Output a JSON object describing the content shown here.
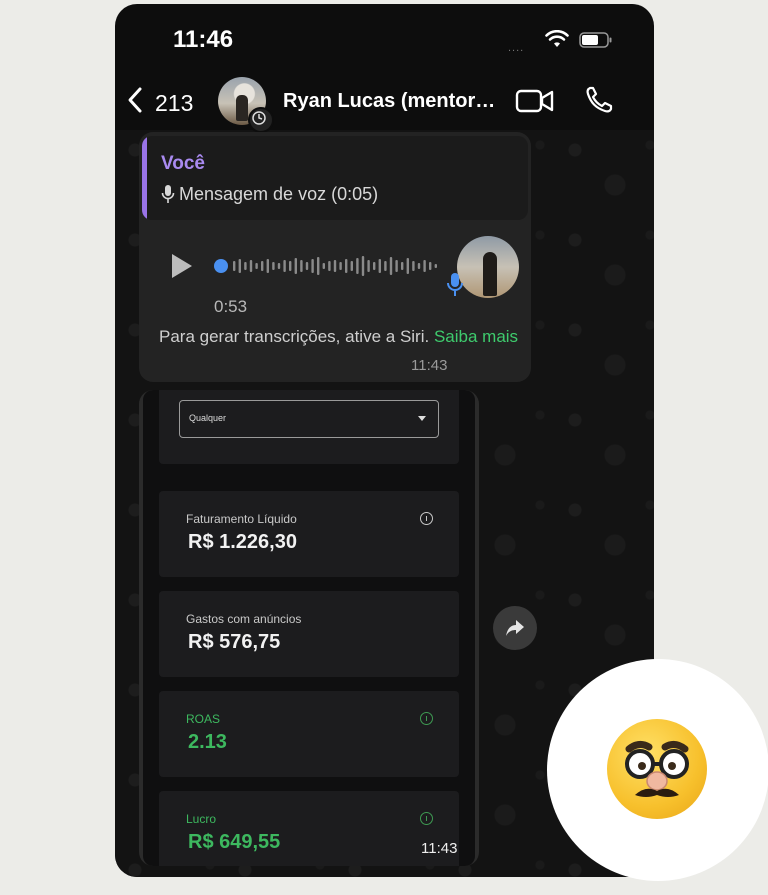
{
  "status_bar": {
    "time": "11:46",
    "signal": "....",
    "wifi_icon": "wifi-icon",
    "battery_icon": "battery-icon"
  },
  "header": {
    "back_count": "213",
    "contact_name": "Ryan Lucas (mentora...",
    "back_icon": "chevron-left-icon",
    "video_icon": "video-camera-icon",
    "call_icon": "phone-icon"
  },
  "voice_message": {
    "reply": {
      "author": "Você",
      "text": "Mensagem de voz (0:05)"
    },
    "duration": "0:53",
    "transcription_notice": "Para gerar transcrições, ative a Siri.",
    "learn_more": "Saiba mais",
    "time": "11:43"
  },
  "image_message": {
    "dropdown_value": "Qualquer",
    "metrics": [
      {
        "label": "Faturamento Líquido",
        "value": "R$ 1.226,30",
        "highlight": false
      },
      {
        "label": "Gastos com anúncios",
        "value": "R$ 576,75",
        "highlight": false
      },
      {
        "label": "ROAS",
        "value": "2.13",
        "highlight": true
      },
      {
        "label": "Lucro",
        "value": "R$ 649,55",
        "highlight": true
      }
    ],
    "time": "11:43"
  },
  "colors": {
    "accent_purple": "#a98af0",
    "link_green": "#3ecb6d",
    "metric_green": "#3db85f",
    "voice_blue": "#4a90f0"
  },
  "reaction_emoji": "disguised-face-emoji"
}
